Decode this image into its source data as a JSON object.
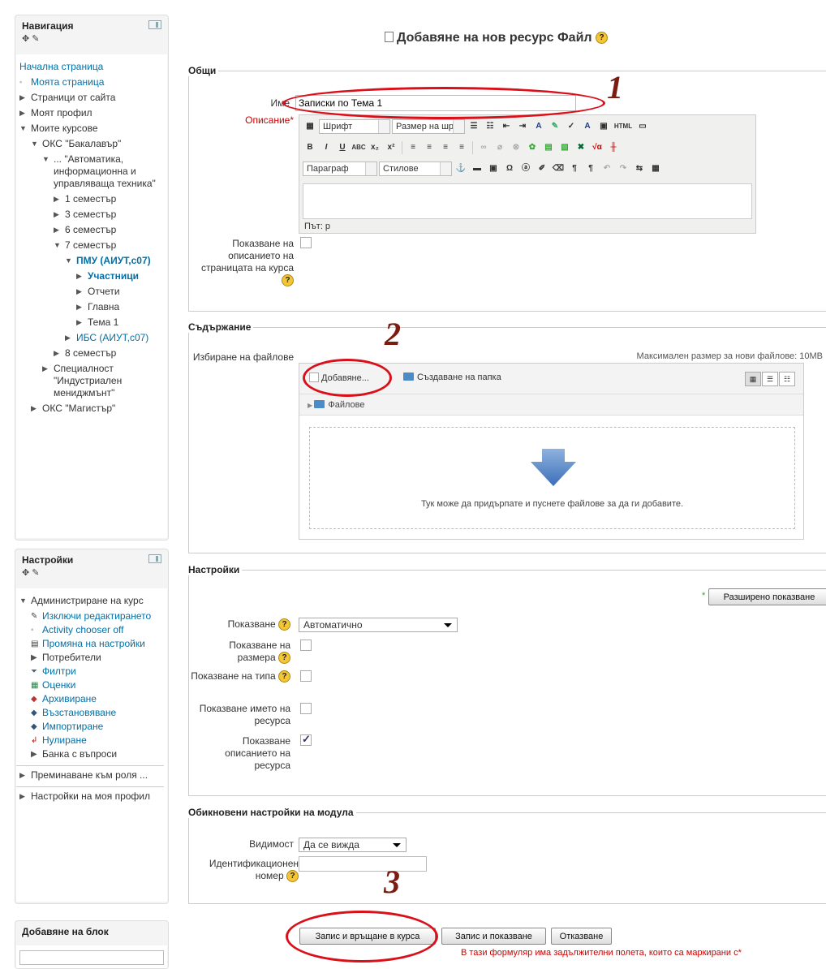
{
  "nav_block": {
    "title": "Навигация",
    "items": [
      {
        "label": "Начална страница",
        "type": "link"
      },
      {
        "label": "Моята страница",
        "type": "bullet"
      },
      {
        "label": "Страници от сайта",
        "type": "collapsed"
      },
      {
        "label": "Моят профил",
        "type": "collapsed"
      },
      {
        "label": "Моите курсове",
        "type": "expanded"
      },
      {
        "label": "ОКС \"Бакалавър\"",
        "type": "expanded"
      },
      {
        "label": "... \"Автоматика, информационна и управляваща техника\"",
        "type": "expanded"
      },
      {
        "label": "1 семестър",
        "type": "collapsed"
      },
      {
        "label": "3 семестър",
        "type": "collapsed"
      },
      {
        "label": "6 семестър",
        "type": "collapsed"
      },
      {
        "label": "7 семестър",
        "type": "expanded"
      },
      {
        "label": "ПМУ (АИУТ,с07)",
        "type": "expanded-current"
      },
      {
        "label": "Участници",
        "type": "collapsed-link"
      },
      {
        "label": "Отчети",
        "type": "collapsed"
      },
      {
        "label": "Главна",
        "type": "collapsed"
      },
      {
        "label": "Тема 1",
        "type": "collapsed"
      },
      {
        "label": "ИБС (АИУТ,с07)",
        "type": "collapsed-link"
      },
      {
        "label": "8 семестър",
        "type": "collapsed"
      },
      {
        "label": "Специалност \"Индустриален мениджмънт\"",
        "type": "collapsed"
      },
      {
        "label": "ОКС \"Магистър\"",
        "type": "collapsed"
      }
    ]
  },
  "settings_block": {
    "title": "Настройки",
    "admin_label": "Администриране на курс",
    "items": [
      {
        "label": "Изключи редактирането",
        "icon": "pencil-icon"
      },
      {
        "label": "Activity chooser off",
        "icon": "bullet-icon"
      },
      {
        "label": "Промяна на настройки",
        "icon": "settings-doc-icon"
      },
      {
        "label": "Потребители",
        "icon": "collapsed-arrow-icon"
      },
      {
        "label": "Филтри",
        "icon": "filter-icon"
      },
      {
        "label": "Оценки",
        "icon": "grades-icon"
      },
      {
        "label": "Архивиране",
        "icon": "backup-icon"
      },
      {
        "label": "Възстановяване",
        "icon": "restore-icon"
      },
      {
        "label": "Импортиране",
        "icon": "import-icon"
      },
      {
        "label": "Нулиране",
        "icon": "reset-icon"
      },
      {
        "label": "Банка с въпроси",
        "icon": "collapsed-arrow-icon"
      }
    ],
    "switch_role": "Преминаване към роля ...",
    "profile_settings": "Настройки на моя профил"
  },
  "add_block": {
    "title": "Добавяне на блок"
  },
  "page": {
    "title": "Добавяне на нов ресурс Файл"
  },
  "general": {
    "legend": "Общи",
    "name_label": "Име",
    "name_value": "Записки по Тема 1",
    "description_label": "Описание",
    "show_desc_label": "Показване на описанието на страницата на курса"
  },
  "editor": {
    "font_label": "Шрифт",
    "size_label": "Размер на шр",
    "paragraph_label": "Параграф",
    "styles_label": "Стилове",
    "path_label": "Път: p"
  },
  "content": {
    "legend": "Съдържание",
    "select_files_label": "Избиране на файлове",
    "max_size": "Максимален размер за нови файлове: 10MB",
    "add_label": "Добавяне...",
    "create_folder_label": "Създаване на папка",
    "files_label": "Файлове",
    "drop_hint": "Тук може да придърпате и пуснете файлове за да ги добавите."
  },
  "settings": {
    "legend": "Настройки",
    "advanced_button": "Разширено показване",
    "display_label": "Показване",
    "display_value": "Автоматично",
    "show_size_label": "Показване на размера",
    "show_type_label": "Показване на типа",
    "show_name_label": "Показване името на ресурса",
    "show_resource_desc_label": "Показване описанието на ресурса",
    "show_resource_desc_checked": true
  },
  "module": {
    "legend": "Обикновени настройки на модула",
    "visibility_label": "Видимост",
    "visibility_value": "Да се вижда",
    "idnumber_label": "Идентификационен номер"
  },
  "buttons": {
    "save_return": "Запис и връщане в курса",
    "save_display": "Запис и показване",
    "cancel": "Отказване"
  },
  "footer_note": "В тази формуляр има задължителни полета, които са маркирани с",
  "annotations": [
    "1",
    "2",
    "3"
  ],
  "colors": {
    "accent_link": "#0070a8",
    "annotation_red": "#d9101a",
    "required": "#cc0000"
  }
}
